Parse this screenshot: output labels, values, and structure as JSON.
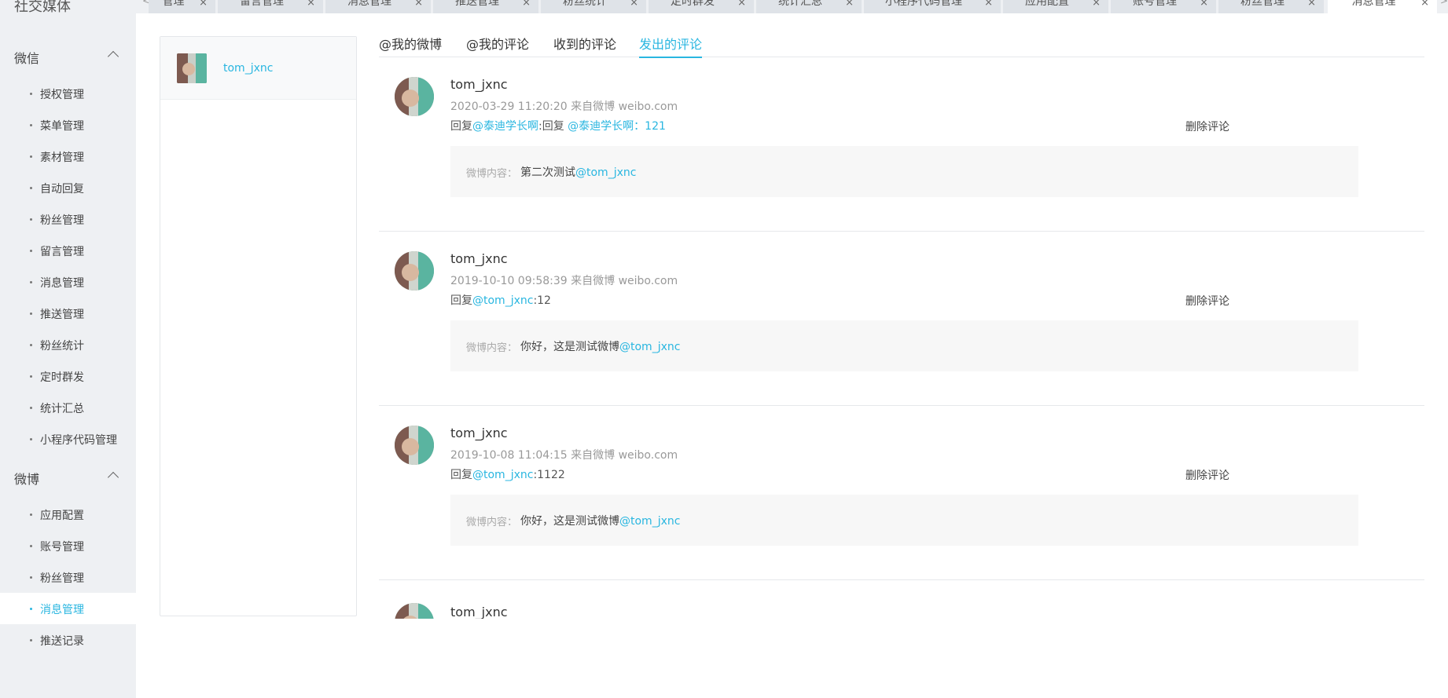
{
  "sidebar": {
    "brand": "社交媒体",
    "groups": [
      {
        "label": "微信",
        "items": [
          "授权管理",
          "菜单管理",
          "素材管理",
          "自动回复",
          "粉丝管理",
          "留言管理",
          "消息管理",
          "推送管理",
          "粉丝统计",
          "定时群发",
          "统计汇总",
          "小程序代码管理"
        ]
      },
      {
        "label": "微博",
        "items": [
          "应用配置",
          "账号管理",
          "粉丝管理",
          "消息管理",
          "推送记录"
        ]
      }
    ],
    "active_item": "消息管理"
  },
  "tabs": {
    "items": [
      "管理",
      "留言管理",
      "消息管理",
      "推送管理",
      "粉丝统计",
      "定时群发",
      "统计汇总",
      "小程序代码管理",
      "应用配置",
      "账号管理",
      "粉丝管理",
      "消息管理"
    ],
    "close_glyph": "×",
    "active_index": 11
  },
  "account": {
    "name": "tom_jxnc"
  },
  "subtabs": {
    "items": [
      "@我的微博",
      "@我的评论",
      "收到的评论",
      "发出的评论"
    ],
    "active_index": 3
  },
  "comments": [
    {
      "user": "tom_jxnc",
      "meta": "2020-03-29 11:20:20 来自微博 weibo.com",
      "reply_prefix": "回复",
      "reply_link1": "@泰迪学长啊",
      "reply_mid": ":回复 ",
      "reply_link2": "@泰迪学长啊：121",
      "reply_tail": "",
      "delete_label": "删除评论",
      "box_prefix": "微博内容：",
      "box_text": "第二次测试",
      "box_link": "@tom_jxnc"
    },
    {
      "user": "tom_jxnc",
      "meta": "2019-10-10 09:58:39 来自微博 weibo.com",
      "reply_prefix": "回复",
      "reply_link1": "@tom_jxnc",
      "reply_mid": ":12",
      "reply_link2": "",
      "reply_tail": "",
      "delete_label": "删除评论",
      "box_prefix": "微博内容：",
      "box_text": "你好，这是测试微博",
      "box_link": "@tom_jxnc"
    },
    {
      "user": "tom_jxnc",
      "meta": "2019-10-08 11:04:15 来自微博 weibo.com",
      "reply_prefix": "回复",
      "reply_link1": "@tom_jxnc",
      "reply_mid": ":1122",
      "reply_link2": "",
      "reply_tail": "",
      "delete_label": "删除评论",
      "box_prefix": "微博内容：",
      "box_text": "你好，这是测试微博",
      "box_link": "@tom_jxnc"
    },
    {
      "user": "tom_jxnc"
    }
  ]
}
